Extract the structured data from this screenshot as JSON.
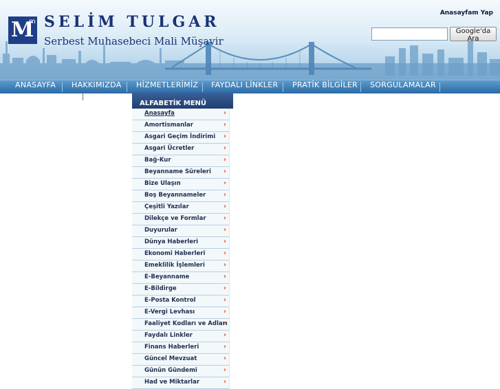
{
  "header": {
    "logo_letter": "M",
    "logo_sup": "m",
    "title": "SELİM TULGAR",
    "subtitle": "Serbest Muhasebeci Mali Müşavir",
    "homepage_link": "Anasayfam Yap",
    "search": {
      "value": "",
      "placeholder": ""
    },
    "search_button": "Google'da Ara"
  },
  "nav": [
    "ANASAYFA",
    "HAKKIMIZDA",
    "HİZMETLERİMİZ",
    "FAYDALI LİNKLER",
    "PRATİK BİLGİLER",
    "SORGULAMALAR"
  ],
  "menu": {
    "title": "ALFABETİK MENÜ",
    "items": [
      "Anasayfa",
      "Amortismanlar",
      "Asgari Geçim İndirimi",
      "Asgari Ücretler",
      "Bağ-Kur",
      "Beyanname Süreleri",
      "Bize Ulaşın",
      "Boş Beyannameler",
      "Çeşitli Yazılar",
      "Dilekçe ve Formlar",
      "Duyurular",
      "Dünya Haberleri",
      "Ekonomi Haberleri",
      "Emeklilik İşlemleri",
      "E-Beyanname",
      "E-Bildirge",
      "E-Posta Kontrol",
      "E-Vergi Levhası",
      "Faaliyet Kodları ve Adları",
      "Faydalı Linkler",
      "Finans Haberleri",
      "Güncel Mevzuat",
      "Günün Gündemi",
      "Had ve Miktarlar"
    ],
    "arrow_icon": "chevron-right-icon"
  },
  "colors": {
    "brand": "#1a3274",
    "nav": "#2a6aa6",
    "menu_header": "#213e70",
    "arrow": "#e0551a"
  }
}
